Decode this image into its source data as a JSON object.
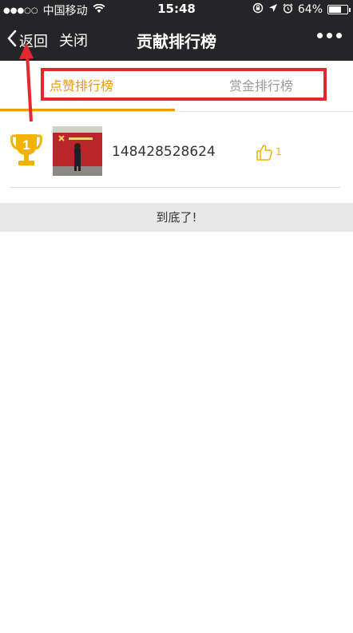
{
  "status_bar": {
    "signal": "●●●○○",
    "carrier": "中国移动",
    "time": "15:48",
    "battery": "64%",
    "icons": [
      "wifi-icon",
      "rotation-lock-icon",
      "location-icon",
      "alarm-icon",
      "battery-icon"
    ]
  },
  "nav": {
    "back_label": "返回",
    "close_label": "关闭",
    "title": "贡献排行榜",
    "more_icon": "more-dots-icon"
  },
  "tabs": {
    "active_label": "点赞排行榜",
    "inactive_label": "赏金排行榜"
  },
  "ranking": [
    {
      "rank": "1",
      "user_id": "148428528624",
      "likes": "1"
    }
  ],
  "footer": {
    "end_text": "到底了!"
  },
  "colors": {
    "accent": "#f39800",
    "nav_bg": "#252527",
    "annotation": "#e8262d",
    "trophy": "#f3b100"
  }
}
